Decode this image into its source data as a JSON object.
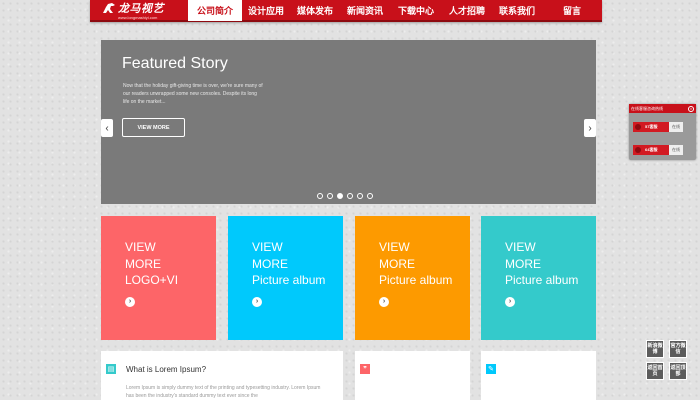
{
  "nav": {
    "logo_text": "龙马视艺",
    "logo_sub": "www.longmashiyi.com",
    "items": [
      "公司简介",
      "设计应用",
      "媒体发布",
      "新闻资讯",
      "下载中心",
      "人才招聘",
      "联系我们",
      "留言"
    ],
    "active_index": 0
  },
  "slider": {
    "title": "Featured Story",
    "body": "Now that the holiday gift-giving time is over, we're sure many of our readers unwrapped some new consoles. Despite its long life on the market...",
    "button": "VIEW MORE",
    "prev": "‹",
    "next": "›",
    "dot_count": 6,
    "active_dot": 2
  },
  "tiles": [
    {
      "lines": [
        "VIEW",
        "MORE",
        "LOGO+VI"
      ],
      "color": "#fd6568"
    },
    {
      "lines": [
        "VIEW",
        "MORE",
        "Picture album"
      ],
      "color": "#00c9fc"
    },
    {
      "lines": [
        "VIEW",
        "MORE",
        "Picture album"
      ],
      "color": "#fd9a00"
    },
    {
      "lines": [
        "VIEW",
        "MORE",
        "Picture album"
      ],
      "color": "#34cacb"
    }
  ],
  "cards": {
    "first": {
      "title": "What is Lorem Ipsum?",
      "text": "Lorem Ipsum is simply dummy text of the printing and typesetting industry. Lorem Ipsum has been the industry's standard dummy text ever since the",
      "icon_color": "#34cacb"
    },
    "second": {
      "icon": "quote-icon",
      "icon_color": "#fd6568"
    },
    "third": {
      "icon": "edit-icon",
      "icon_color": "#00c9fc"
    }
  },
  "widget": {
    "title": "在线客服咨询热线",
    "rows": [
      {
        "label": "57客服",
        "button": "在线"
      },
      {
        "label": "64客服",
        "button": "在线"
      }
    ]
  },
  "quick_links": [
    "新浪微博",
    "官方微信",
    "返回首页",
    "返回顶部"
  ],
  "colors": {
    "brand_red": "#c8101a"
  }
}
